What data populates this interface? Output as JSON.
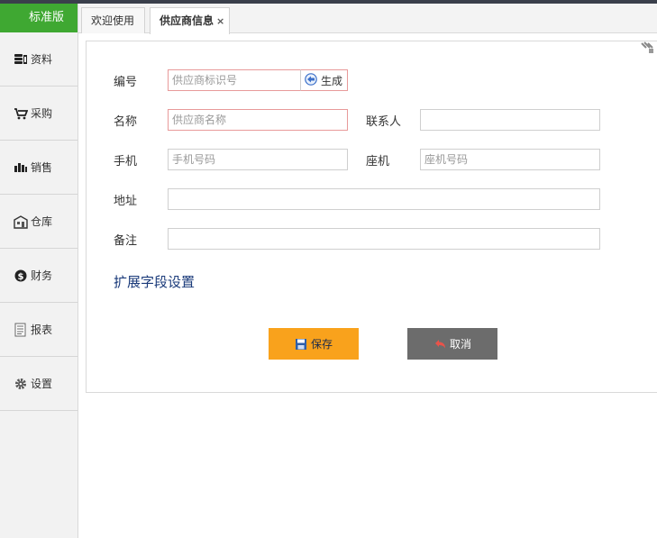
{
  "sidebar": {
    "edition": "标准版",
    "items": [
      {
        "label": "资料",
        "icon": "database-icon"
      },
      {
        "label": "采购",
        "icon": "cart-icon"
      },
      {
        "label": "销售",
        "icon": "sales-icon"
      },
      {
        "label": "仓库",
        "icon": "warehouse-icon"
      },
      {
        "label": "财务",
        "icon": "dollar-icon"
      },
      {
        "label": "报表",
        "icon": "report-icon"
      },
      {
        "label": "设置",
        "icon": "gear-icon"
      }
    ]
  },
  "tabs": [
    {
      "label": "欢迎使用"
    },
    {
      "label": "供应商信息",
      "close": "×"
    }
  ],
  "form": {
    "code": {
      "label": "编号",
      "placeholder": "供应商标识号",
      "value": ""
    },
    "generate_label": "生成",
    "name": {
      "label": "名称",
      "placeholder": "供应商名称",
      "value": ""
    },
    "contact": {
      "label": "联系人",
      "placeholder": "",
      "value": ""
    },
    "mobile": {
      "label": "手机",
      "placeholder": "手机号码",
      "value": ""
    },
    "phone": {
      "label": "座机",
      "placeholder": "座机号码",
      "value": ""
    },
    "address": {
      "label": "地址",
      "placeholder": "",
      "value": ""
    },
    "remark": {
      "label": "备注",
      "placeholder": "",
      "value": ""
    },
    "extend_link": "扩展字段设置",
    "save_label": "保存",
    "cancel_label": "取消"
  },
  "colors": {
    "edition_bg": "#3fa832",
    "save_bg": "#f9a21c",
    "cancel_bg": "#6c6c6c",
    "required_border": "#e89a9a",
    "link": "#1a3a7a"
  }
}
